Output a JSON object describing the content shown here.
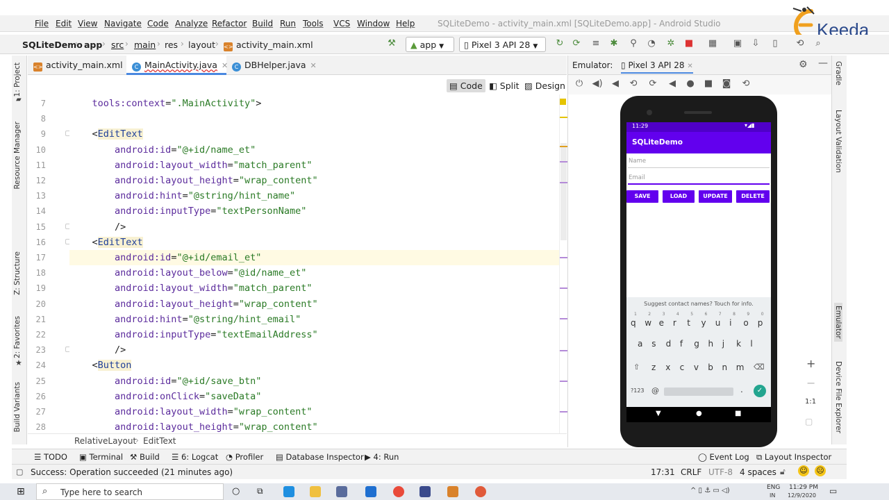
{
  "menu": {
    "items": [
      "File",
      "Edit",
      "View",
      "Navigate",
      "Code",
      "Analyze",
      "Refactor",
      "Build",
      "Run",
      "Tools",
      "VCS",
      "Window",
      "Help"
    ],
    "window_title": "SQLiteDemo - activity_main.xml [SQLiteDemo.app] - Android Studio"
  },
  "breadcrumb": [
    "SQLiteDemo",
    "app",
    "src",
    "main",
    "res",
    "layout",
    "activity_main.xml"
  ],
  "run_config": "app",
  "device": "Pixel 3 API 28",
  "tabs": [
    {
      "label": "activity_main.xml",
      "type": "xml"
    },
    {
      "label": "MainActivity.java",
      "type": "java"
    },
    {
      "label": "DBHelper.java",
      "type": "java"
    }
  ],
  "view_modes": [
    "Code",
    "Split",
    "Design"
  ],
  "code_lines": [
    {
      "n": "7",
      "indent": "    ",
      "parts": [
        [
          "attr",
          "tools:context"
        ],
        [
          "plain",
          "="
        ],
        [
          "val",
          "\".MainActivity\""
        ],
        [
          "plain",
          ">"
        ]
      ]
    },
    {
      "n": "8",
      "indent": "",
      "parts": []
    },
    {
      "n": "9",
      "indent": "    ",
      "parts": [
        [
          "plain",
          "<"
        ],
        [
          "tag",
          "EditText"
        ]
      ]
    },
    {
      "n": "10",
      "indent": "        ",
      "parts": [
        [
          "attr",
          "android:id"
        ],
        [
          "plain",
          "="
        ],
        [
          "val",
          "\"@+id/name_et\""
        ]
      ]
    },
    {
      "n": "11",
      "indent": "        ",
      "parts": [
        [
          "attr",
          "android:layout_width"
        ],
        [
          "plain",
          "="
        ],
        [
          "val",
          "\"match_parent\""
        ]
      ]
    },
    {
      "n": "12",
      "indent": "        ",
      "parts": [
        [
          "attr",
          "android:layout_height"
        ],
        [
          "plain",
          "="
        ],
        [
          "val",
          "\"wrap_content\""
        ]
      ]
    },
    {
      "n": "13",
      "indent": "        ",
      "parts": [
        [
          "attr",
          "android:hint"
        ],
        [
          "plain",
          "="
        ],
        [
          "val",
          "\"@string/hint_name\""
        ]
      ]
    },
    {
      "n": "14",
      "indent": "        ",
      "parts": [
        [
          "attr",
          "android:inputType"
        ],
        [
          "plain",
          "="
        ],
        [
          "val",
          "\"textPersonName\""
        ]
      ]
    },
    {
      "n": "15",
      "indent": "        ",
      "parts": [
        [
          "plain",
          "/>"
        ]
      ]
    },
    {
      "n": "16",
      "indent": "    ",
      "parts": [
        [
          "plain",
          "<"
        ],
        [
          "tag",
          "EditText"
        ]
      ]
    },
    {
      "n": "17",
      "indent": "        ",
      "parts": [
        [
          "attr",
          "android:id"
        ],
        [
          "plain",
          "="
        ],
        [
          "val",
          "\"@+id/email_et\""
        ]
      ]
    },
    {
      "n": "18",
      "indent": "        ",
      "parts": [
        [
          "attr",
          "android:layout_below"
        ],
        [
          "plain",
          "="
        ],
        [
          "val",
          "\"@id/name_et\""
        ]
      ]
    },
    {
      "n": "19",
      "indent": "        ",
      "parts": [
        [
          "attr",
          "android:layout_width"
        ],
        [
          "plain",
          "="
        ],
        [
          "val",
          "\"match_parent\""
        ]
      ]
    },
    {
      "n": "20",
      "indent": "        ",
      "parts": [
        [
          "attr",
          "android:layout_height"
        ],
        [
          "plain",
          "="
        ],
        [
          "val",
          "\"wrap_content\""
        ]
      ]
    },
    {
      "n": "21",
      "indent": "        ",
      "parts": [
        [
          "attr",
          "android:hint"
        ],
        [
          "plain",
          "="
        ],
        [
          "val",
          "\"@string/hint_email\""
        ]
      ]
    },
    {
      "n": "22",
      "indent": "        ",
      "parts": [
        [
          "attr",
          "android:inputType"
        ],
        [
          "plain",
          "="
        ],
        [
          "val",
          "\"textEmailAddress\""
        ]
      ]
    },
    {
      "n": "23",
      "indent": "        ",
      "parts": [
        [
          "plain",
          "/>"
        ]
      ]
    },
    {
      "n": "24",
      "indent": "    ",
      "parts": [
        [
          "plain",
          "<"
        ],
        [
          "tag",
          "Button"
        ]
      ]
    },
    {
      "n": "25",
      "indent": "        ",
      "parts": [
        [
          "attr",
          "android:id"
        ],
        [
          "plain",
          "="
        ],
        [
          "val",
          "\"@+id/save_btn\""
        ]
      ]
    },
    {
      "n": "26",
      "indent": "        ",
      "parts": [
        [
          "attr",
          "android:onClick"
        ],
        [
          "plain",
          "="
        ],
        [
          "val",
          "\"saveData\""
        ]
      ]
    },
    {
      "n": "27",
      "indent": "        ",
      "parts": [
        [
          "attr",
          "android:layout_width"
        ],
        [
          "plain",
          "="
        ],
        [
          "val",
          "\"wrap_content\""
        ]
      ]
    },
    {
      "n": "28",
      "indent": "        ",
      "parts": [
        [
          "attr",
          "android:layout_height"
        ],
        [
          "plain",
          "="
        ],
        [
          "val",
          "\"wrap_content\""
        ]
      ]
    }
  ],
  "editor_breadcrumb": [
    "RelativeLayout",
    "EditText"
  ],
  "left_tabs": [
    "1: Project",
    "Resource Manager",
    "Z: Structure",
    "2: Favorites",
    "Build Variants"
  ],
  "right_tabs": [
    "Gradle",
    "Layout Validation",
    "Emulator",
    "Device File Explorer"
  ],
  "emulator": {
    "label": "Emulator:",
    "device_tab": "Pixel 3 API 28",
    "time": "11:29",
    "app_title": "SQLiteDemo",
    "name_hint": "Name",
    "email_hint": "Email",
    "buttons": [
      "SAVE",
      "LOAD",
      "UPDATE",
      "DELETE"
    ],
    "suggest": "Suggest contact names? Touch for info.",
    "kb_digits": [
      "1",
      "2",
      "3",
      "4",
      "5",
      "6",
      "7",
      "8",
      "9",
      "0"
    ],
    "kb_row1": [
      "q",
      "w",
      "e",
      "r",
      "t",
      "y",
      "u",
      "i",
      "o",
      "p"
    ],
    "kb_row2": [
      "a",
      "s",
      "d",
      "f",
      "g",
      "h",
      "j",
      "k",
      "l"
    ],
    "kb_row3": [
      "z",
      "x",
      "c",
      "v",
      "b",
      "n",
      "m"
    ],
    "kb_sym": "?123",
    "kb_at": "@",
    "kb_dot": ".",
    "zoom_ratio": "1:1"
  },
  "toolwindows": [
    "TODO",
    "Terminal",
    "Build",
    "6: Logcat",
    "Profiler",
    "Database Inspector",
    "4: Run"
  ],
  "toolwindows_right": [
    "Event Log",
    "Layout Inspector"
  ],
  "status": {
    "message": "Success: Operation succeeded (21 minutes ago)",
    "position": "17:31",
    "line_sep": "CRLF",
    "encoding": "UTF-8",
    "indent": "4 spaces"
  },
  "taskbar": {
    "search_placeholder": "Type here to search",
    "lang": "ENG",
    "lang2": "IN",
    "time": "11:29 PM",
    "date": "12/9/2020"
  },
  "logo": "Keeda",
  "colors": {
    "accent": "#6200ee",
    "tab_underline": "#4a88e0"
  }
}
